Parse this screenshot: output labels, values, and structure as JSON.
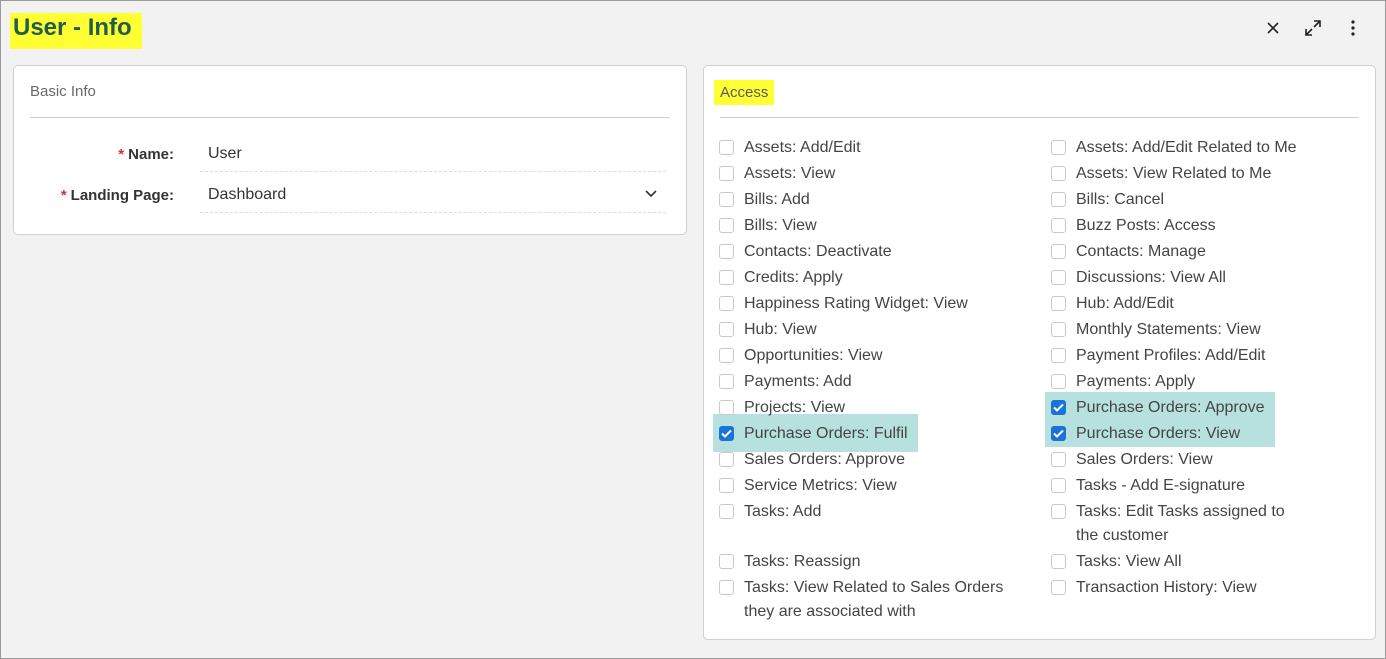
{
  "title": "User - Info",
  "window_actions": {
    "close_icon": "close-icon",
    "expand_icon": "expand-icon",
    "more_icon": "more-vertical-icon"
  },
  "basic_info": {
    "title": "Basic Info",
    "name_label": "Name:",
    "name_value": "User",
    "landing_label": "Landing Page:",
    "landing_value": "Dashboard",
    "required_mark": "*"
  },
  "access": {
    "title": "Access",
    "left": [
      {
        "label": "Assets: Add/Edit",
        "checked": false
      },
      {
        "label": "Assets: View",
        "checked": false
      },
      {
        "label": "Bills: Add",
        "checked": false
      },
      {
        "label": "Bills: View",
        "checked": false
      },
      {
        "label": "Contacts: Deactivate",
        "checked": false
      },
      {
        "label": "Credits: Apply",
        "checked": false
      },
      {
        "label": "Happiness Rating Widget: View",
        "checked": false
      },
      {
        "label": "Hub: View",
        "checked": false
      },
      {
        "label": "Opportunities: View",
        "checked": false
      },
      {
        "label": "Payments: Add",
        "checked": false
      },
      {
        "label": "Projects: View",
        "checked": false
      },
      {
        "label": "Purchase Orders: Fulfil",
        "checked": true
      },
      {
        "label": "Sales Orders: Approve",
        "checked": false
      },
      {
        "label": "Service Metrics: View",
        "checked": false
      },
      {
        "label": "Tasks: Add",
        "checked": false
      },
      {
        "label": "Tasks: Reassign",
        "checked": false
      },
      {
        "label": "Tasks: View Related to Sales Orders they are associated with",
        "checked": false
      }
    ],
    "right": [
      {
        "label": "Assets: Add/Edit Related to Me",
        "checked": false
      },
      {
        "label": "Assets: View Related to Me",
        "checked": false
      },
      {
        "label": "Bills: Cancel",
        "checked": false
      },
      {
        "label": "Buzz Posts: Access",
        "checked": false
      },
      {
        "label": "Contacts: Manage",
        "checked": false
      },
      {
        "label": "Discussions: View All",
        "checked": false
      },
      {
        "label": "Hub: Add/Edit",
        "checked": false
      },
      {
        "label": "Monthly Statements: View",
        "checked": false
      },
      {
        "label": "Payment Profiles: Add/Edit",
        "checked": false
      },
      {
        "label": "Payments: Apply",
        "checked": false
      },
      {
        "label": "Purchase Orders: Approve",
        "checked": true
      },
      {
        "label": "Purchase Orders: View",
        "checked": true
      },
      {
        "label": "Sales Orders: View",
        "checked": false
      },
      {
        "label": "Tasks - Add E-signature",
        "checked": false
      },
      {
        "label": "Tasks: Edit Tasks assigned to the customer",
        "checked": false
      },
      {
        "label": "Tasks: View All",
        "checked": false
      },
      {
        "label": "Transaction History: View",
        "checked": false
      }
    ]
  }
}
